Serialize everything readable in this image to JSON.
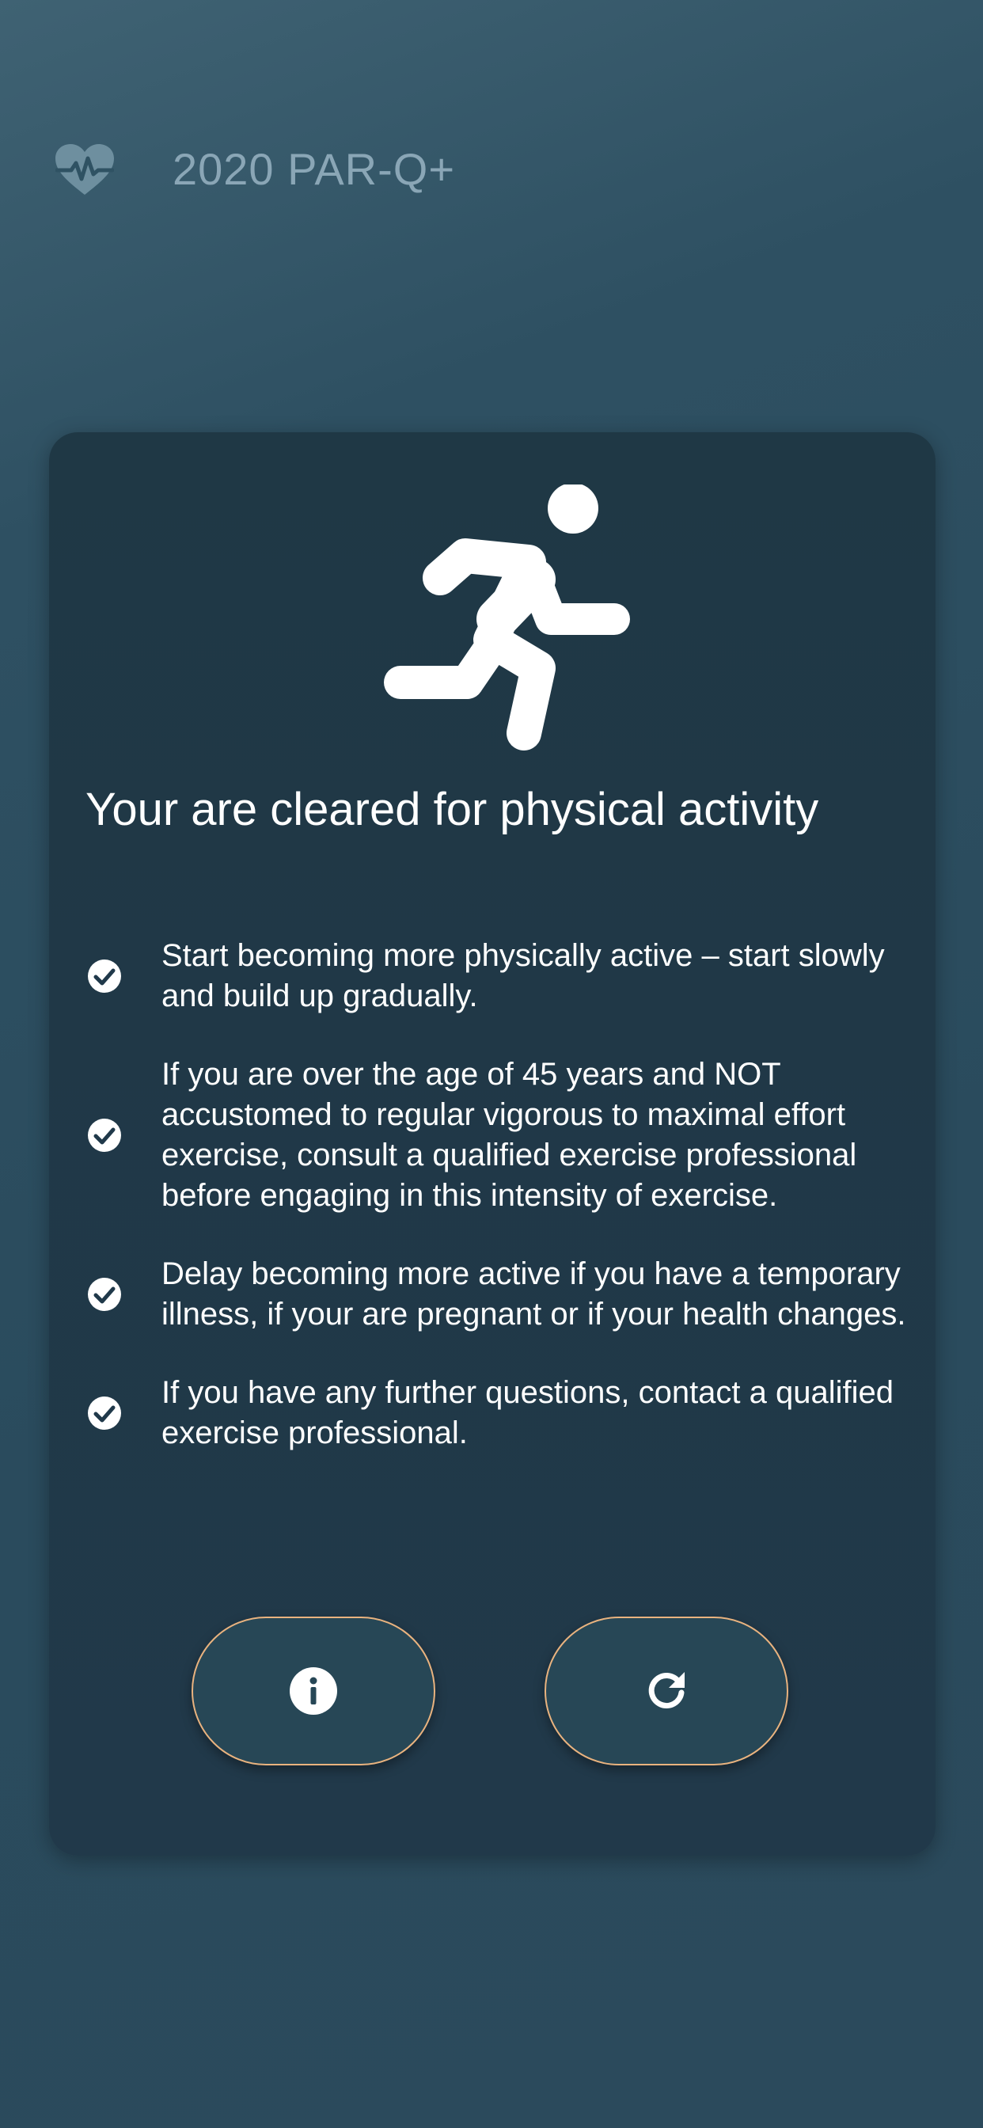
{
  "header": {
    "title": "2020 PAR-Q+",
    "logo_icon": "heart-pulse-icon"
  },
  "card": {
    "hero_icon": "running-person-icon",
    "headline": "Your are cleared for physical activity",
    "items": [
      {
        "icon": "check-circle-icon",
        "text": "Start becoming more physically active – start slowly and build up gradually."
      },
      {
        "icon": "check-circle-icon",
        "text": "If you are over the age of 45 years and NOT accustomed to regular vigorous to maximal effort exercise, consult a qualified exercise professional before engaging in this intensity of exercise."
      },
      {
        "icon": "check-circle-icon",
        "text": "Delay becoming more active if you have a temporary illness, if your are pregnant or if your health changes."
      },
      {
        "icon": "check-circle-icon",
        "text": "If you have any further questions, contact a qualified exercise professional."
      }
    ],
    "buttons": [
      {
        "icon": "info-icon"
      },
      {
        "icon": "refresh-icon"
      }
    ]
  },
  "colors": {
    "background": "#2b4a5c",
    "card": "#21394a",
    "header_text": "#8aa6b6",
    "button_border": "#e9b37f",
    "button_fill": "#274756",
    "text": "#ffffff"
  }
}
